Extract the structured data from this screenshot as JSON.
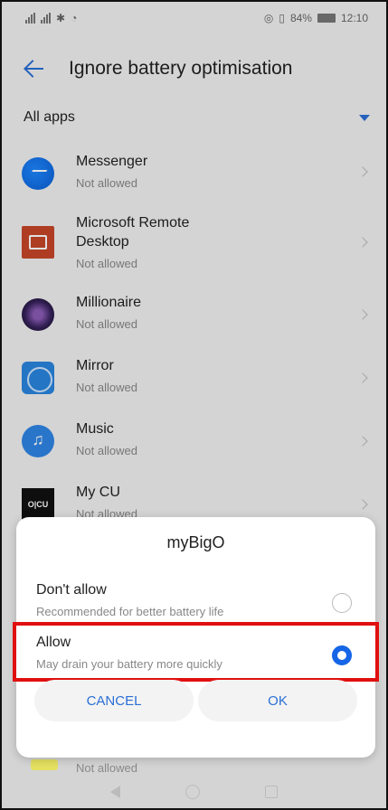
{
  "status_bar": {
    "left_text": "",
    "battery_percent": "84%",
    "time": "12:10"
  },
  "header": {
    "title": "Ignore battery optimisation"
  },
  "filter": {
    "label": "All apps"
  },
  "apps": [
    {
      "name": "Messenger",
      "status": "Not allowed",
      "icon": "messenger-icon"
    },
    {
      "name": "Microsoft Remote Desktop",
      "status": "Not allowed",
      "icon": "remote-desktop-icon"
    },
    {
      "name": "Millionaire",
      "status": "Not allowed",
      "icon": "millionaire-icon"
    },
    {
      "name": "Mirror",
      "status": "Not allowed",
      "icon": "mirror-icon"
    },
    {
      "name": "Music",
      "status": "Not allowed",
      "icon": "music-icon"
    },
    {
      "name": "My CU",
      "status": "Not allowed",
      "icon": "my-cu-icon",
      "icon_text": "O|CU"
    }
  ],
  "partial_item": {
    "status": "Not allowed"
  },
  "dialog": {
    "title": "myBigO",
    "options": [
      {
        "title": "Don't allow",
        "desc": "Recommended for better battery life",
        "selected": false
      },
      {
        "title": "Allow",
        "desc": "May drain your battery more quickly",
        "selected": true
      }
    ],
    "cancel_label": "CANCEL",
    "ok_label": "OK"
  },
  "colors": {
    "accent": "#1565e6",
    "highlight": "#e01010"
  }
}
